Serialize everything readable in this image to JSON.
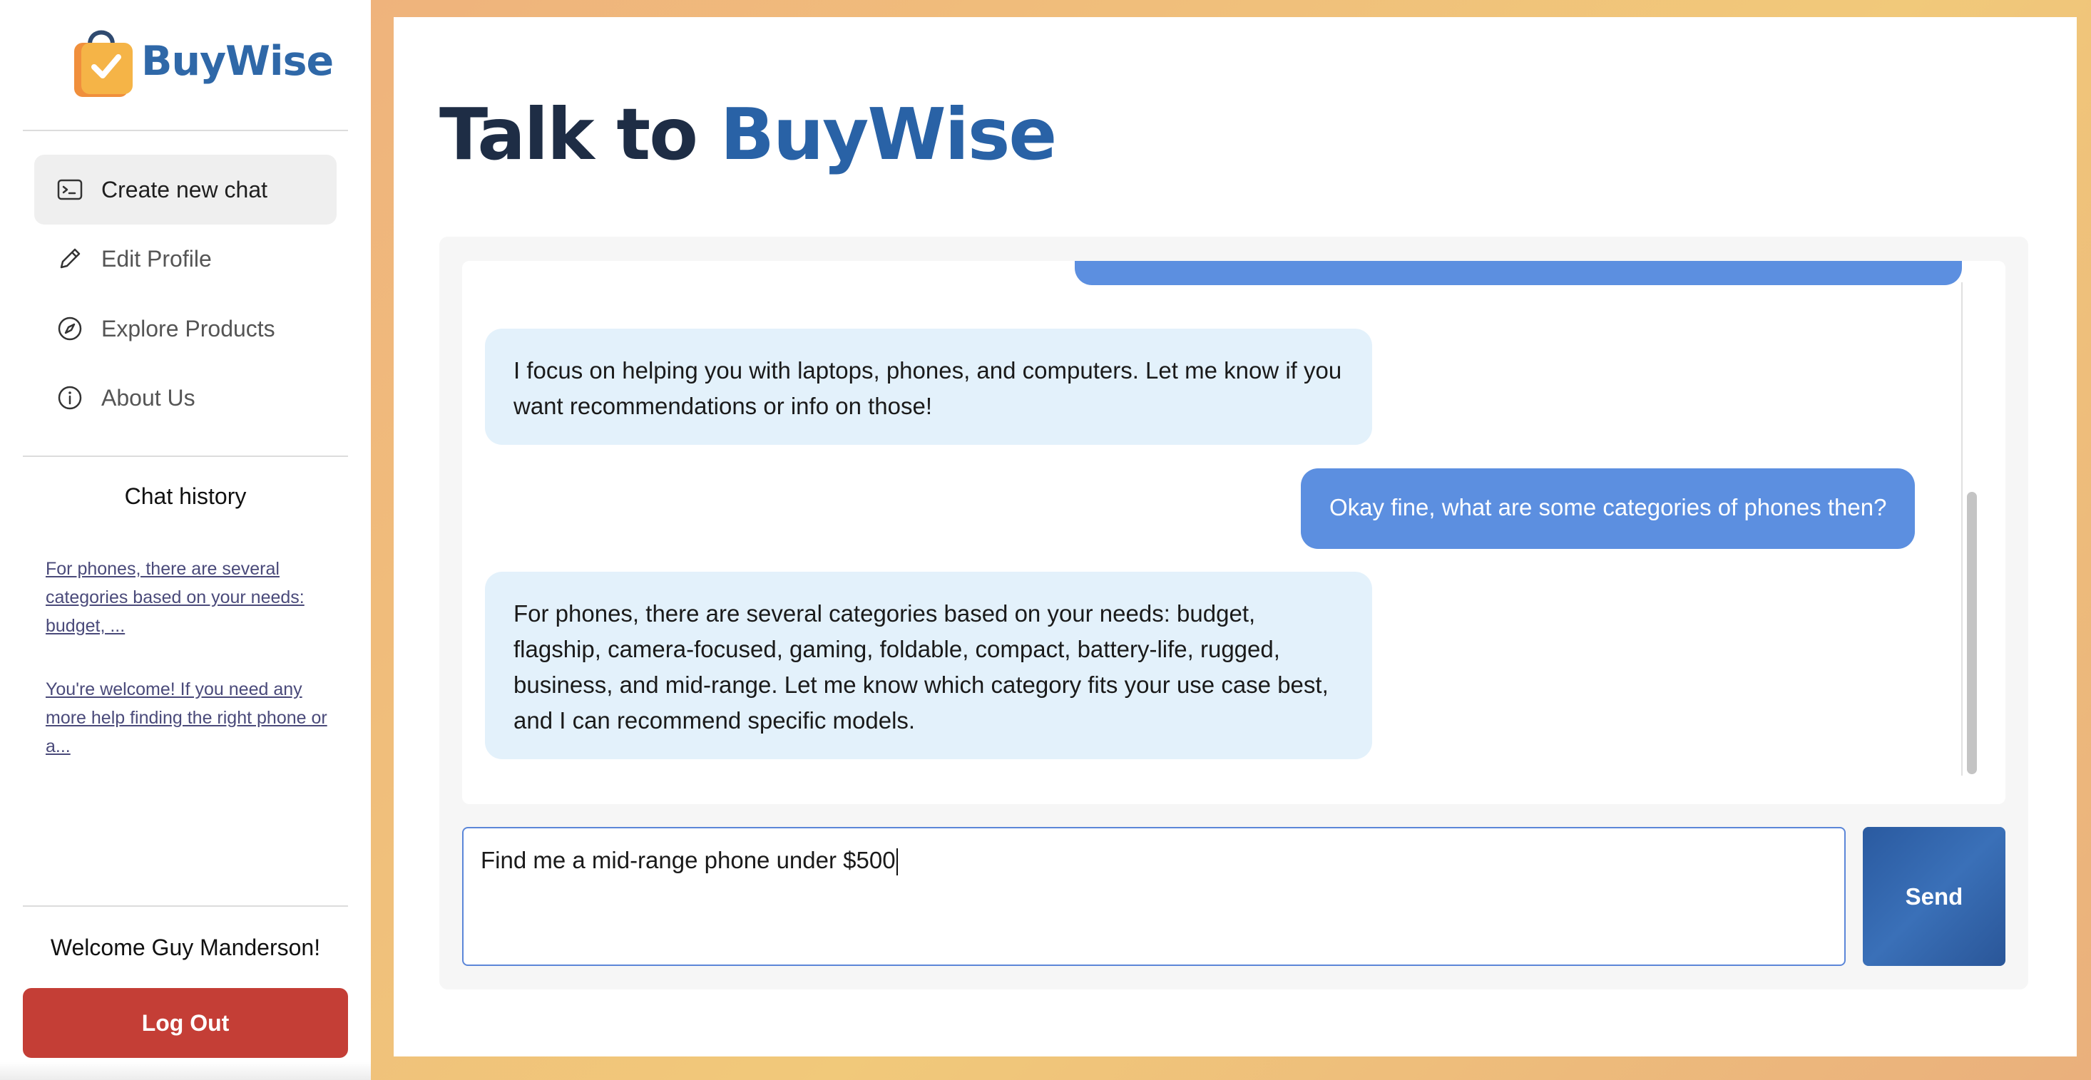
{
  "brand": {
    "name": "BuyWise",
    "primary": "#2f68a8",
    "accent": "#f4a93a"
  },
  "sidebar": {
    "items": [
      {
        "label": "Create new chat",
        "icon": "terminal-icon",
        "active": true
      },
      {
        "label": "Edit Profile",
        "icon": "pencil-icon"
      },
      {
        "label": "Explore Products",
        "icon": "compass-icon"
      },
      {
        "label": "About Us",
        "icon": "info-icon"
      }
    ],
    "history_title": "Chat history",
    "history": [
      "For phones, there are several categories based on your needs: budget, ...",
      "You're welcome! If you need any more help finding the right phone or a..."
    ],
    "welcome": "Welcome Guy Manderson!",
    "logout_label": "Log Out"
  },
  "main": {
    "title_part1": "Talk to",
    "title_part2": "BuyWise",
    "messages": [
      {
        "role": "bot",
        "text": "I focus on helping you with laptops, phones, and computers. Let me know if you want recommendations or info on those!"
      },
      {
        "role": "user",
        "text": "Okay fine, what are some categories of phones then?"
      },
      {
        "role": "bot",
        "text": "For phones, there are several categories based on your needs: budget, flagship, camera-focused, gaming, foldable, compact, battery-life, rugged, business, and mid-range. Let me know which category fits your use case best, and I can recommend specific models."
      }
    ],
    "input_value": "Find me a mid-range phone under $500",
    "send_label": "Send"
  }
}
